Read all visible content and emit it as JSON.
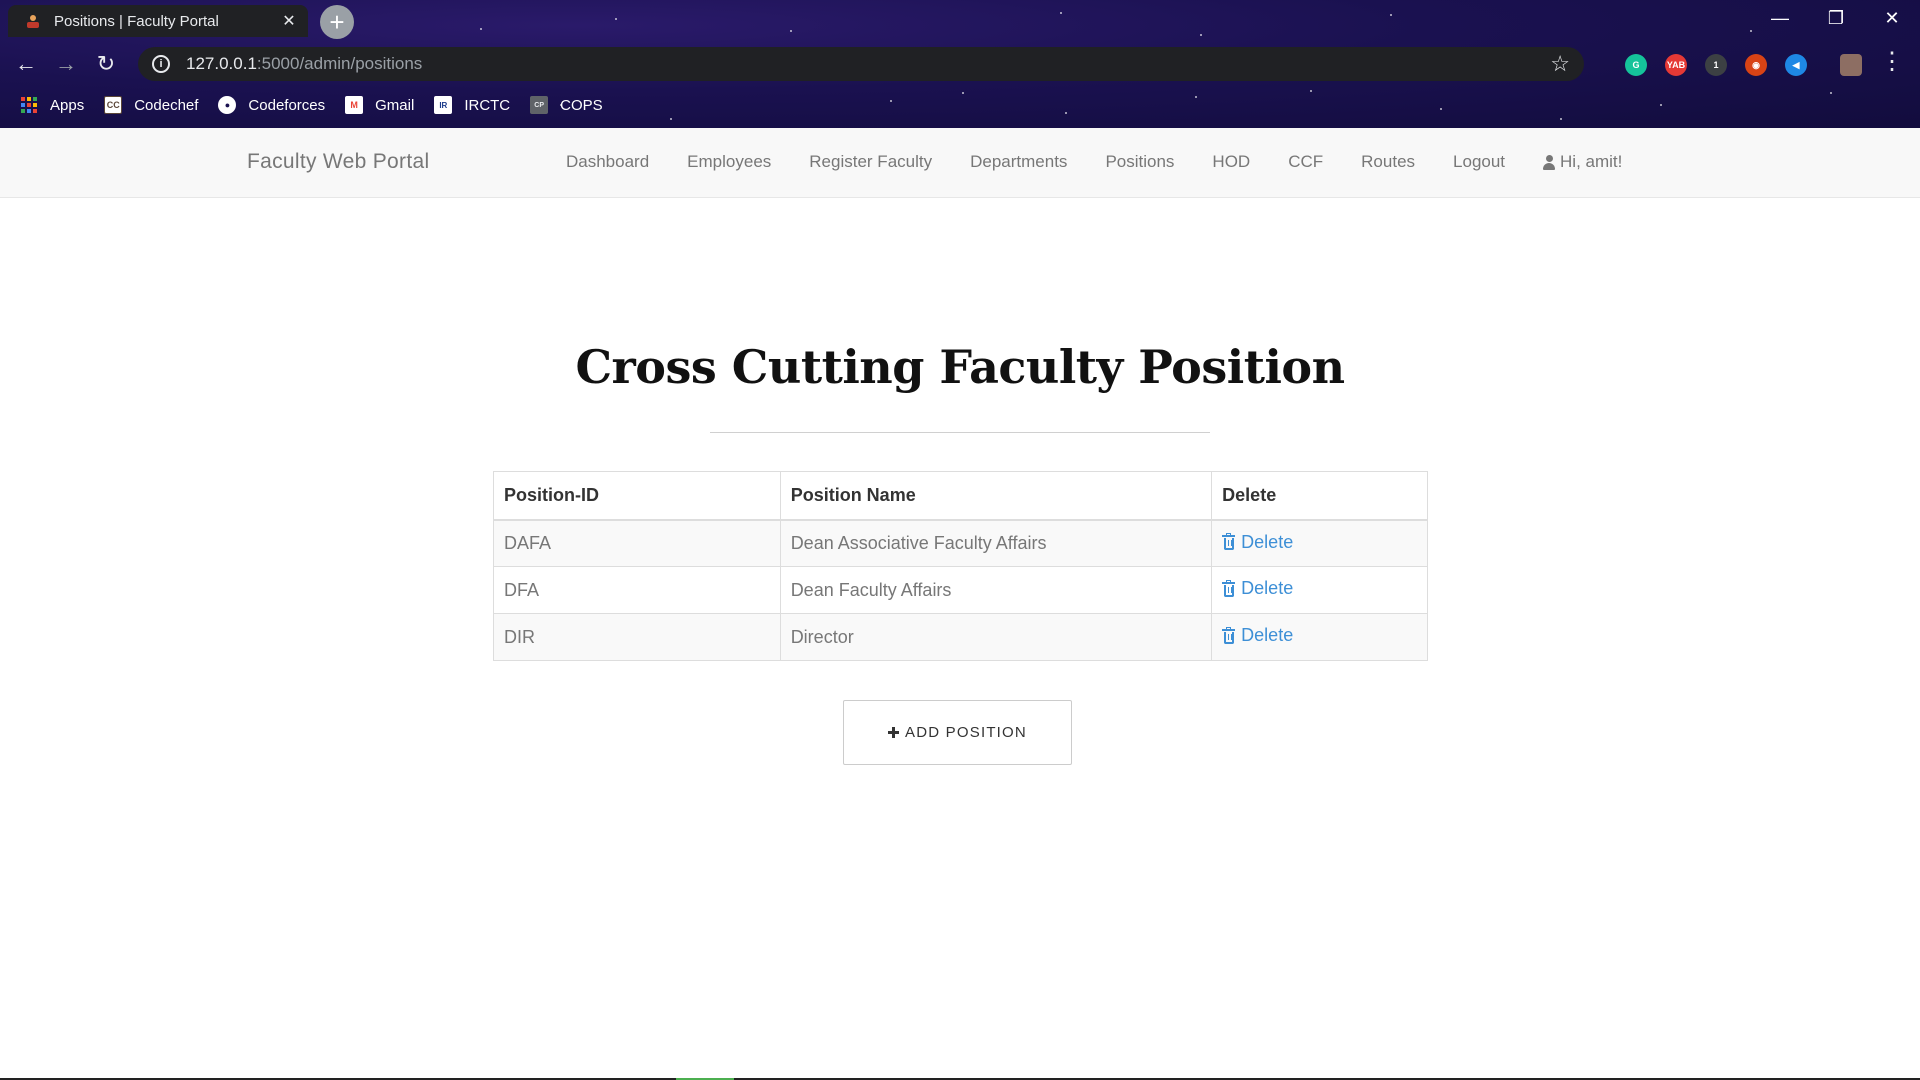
{
  "browser": {
    "tab_title": "Positions | Faculty Portal",
    "tab_close": "✕",
    "new_tab": "+",
    "url_host": "127.0.0.1",
    "url_path": ":5000/admin/positions",
    "window_controls": {
      "minimize": "—",
      "restore": "❐",
      "close": "✕"
    },
    "extensions": [
      {
        "icon": "grammarly-icon",
        "label": "G",
        "color": "#15c39a"
      },
      {
        "icon": "yab-icon",
        "label": "YAB",
        "color": "#e53935"
      },
      {
        "icon": "screen-recorder-icon",
        "label": "1",
        "color": "#3c4043"
      },
      {
        "icon": "eye-extension-icon",
        "label": "◉",
        "color": "#d84315"
      },
      {
        "icon": "speaker-extension-icon",
        "label": "◀",
        "color": "#1e88e5"
      }
    ],
    "bookmarks": [
      {
        "icon": "apps-grid-icon",
        "label": "Apps"
      },
      {
        "icon": "codechef-icon",
        "label": "Codechef",
        "badge": "CC"
      },
      {
        "icon": "codeforces-icon",
        "label": "Codeforces",
        "badge": "●"
      },
      {
        "icon": "gmail-icon",
        "label": "Gmail",
        "badge": "M"
      },
      {
        "icon": "irctc-icon",
        "label": "IRCTC",
        "badge": "IR"
      },
      {
        "icon": "cops-icon",
        "label": "COPS",
        "badge": "CP"
      }
    ]
  },
  "navbar": {
    "brand": "Faculty Web Portal",
    "links": [
      "Dashboard",
      "Employees",
      "Register Faculty",
      "Departments",
      "Positions",
      "HOD",
      "CCF",
      "Routes",
      "Logout"
    ],
    "user_greeting": "Hi, amit!"
  },
  "main": {
    "title": "Cross Cutting Faculty Position",
    "table": {
      "headers": [
        "Position-ID",
        "Position Name",
        "Delete"
      ],
      "rows": [
        {
          "id": "DAFA",
          "name": "Dean Associative Faculty Affairs",
          "action": "Delete"
        },
        {
          "id": "DFA",
          "name": "Dean Faculty Affairs",
          "action": "Delete"
        },
        {
          "id": "DIR",
          "name": "Director",
          "action": "Delete"
        }
      ]
    },
    "add_button": "ADD POSITION"
  },
  "colors": {
    "link_blue": "#3d8fd6",
    "navbar_bg": "#f8f8f8",
    "chrome_bg": "#1a1150"
  }
}
